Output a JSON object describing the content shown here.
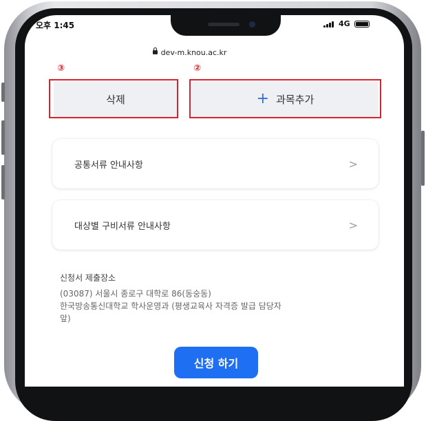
{
  "status_bar": {
    "time": "오후 1:45",
    "network": "4G"
  },
  "browser": {
    "url": "dev-m.knou.ac.kr"
  },
  "annotations": {
    "marker_delete": "③",
    "marker_add": "②"
  },
  "actions": {
    "delete_label": "삭제",
    "add_subject_label": "과목추가"
  },
  "cards": [
    {
      "label": "공통서류 안내사항"
    },
    {
      "label": "대상별 구비서류 안내사항"
    }
  ],
  "submission": {
    "heading": "신청서 제출장소",
    "address_line1": "(03087) 서울시 종로구 대학로 86(동숭동)",
    "address_line2": "한국방송통신대학교 학사운영과 (평생교육사 자격증 발급 담당자",
    "address_line3": "앞)"
  },
  "submit_button": {
    "label": "신청 하기"
  },
  "colors": {
    "accent": "#1f6ff2",
    "annotation": "#d7232f",
    "button_bg": "#eef0f3"
  }
}
